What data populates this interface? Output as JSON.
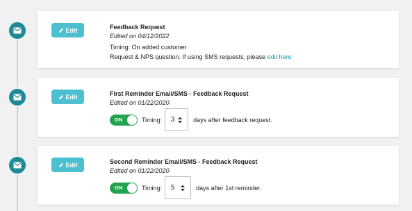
{
  "steps": [
    {
      "icon": "envelope-icon",
      "edit_label": "Edit",
      "title": "Feedback Request",
      "edited": "Edited on 04/12/2022",
      "timing_text": "Timing: On added customer",
      "desc_text": "Request & NPS question. If using SMS requests, please ",
      "desc_link": "edit here"
    },
    {
      "icon": "envelope-icon",
      "edit_label": "Edit",
      "title": "First Reminder Email/SMS - Feedback Request",
      "edited": "Edited on 01/22/2020",
      "toggle": "ON",
      "timing_label": "Timing:",
      "value": "3",
      "suffix": "days after feedback request."
    },
    {
      "icon": "envelope-icon",
      "edit_label": "Edit",
      "title": "Second Reminder Email/SMS - Feedback Request",
      "edited": "Edited on 01/22/2020",
      "toggle": "ON",
      "timing_label": "Timing:",
      "value": "5",
      "suffix": "days after 1st reminder."
    }
  ],
  "colors": {
    "marker": "#1f8a96",
    "edit_button": "#4cbfd1",
    "toggle_on": "#23a34e",
    "link": "#1a9aae"
  }
}
